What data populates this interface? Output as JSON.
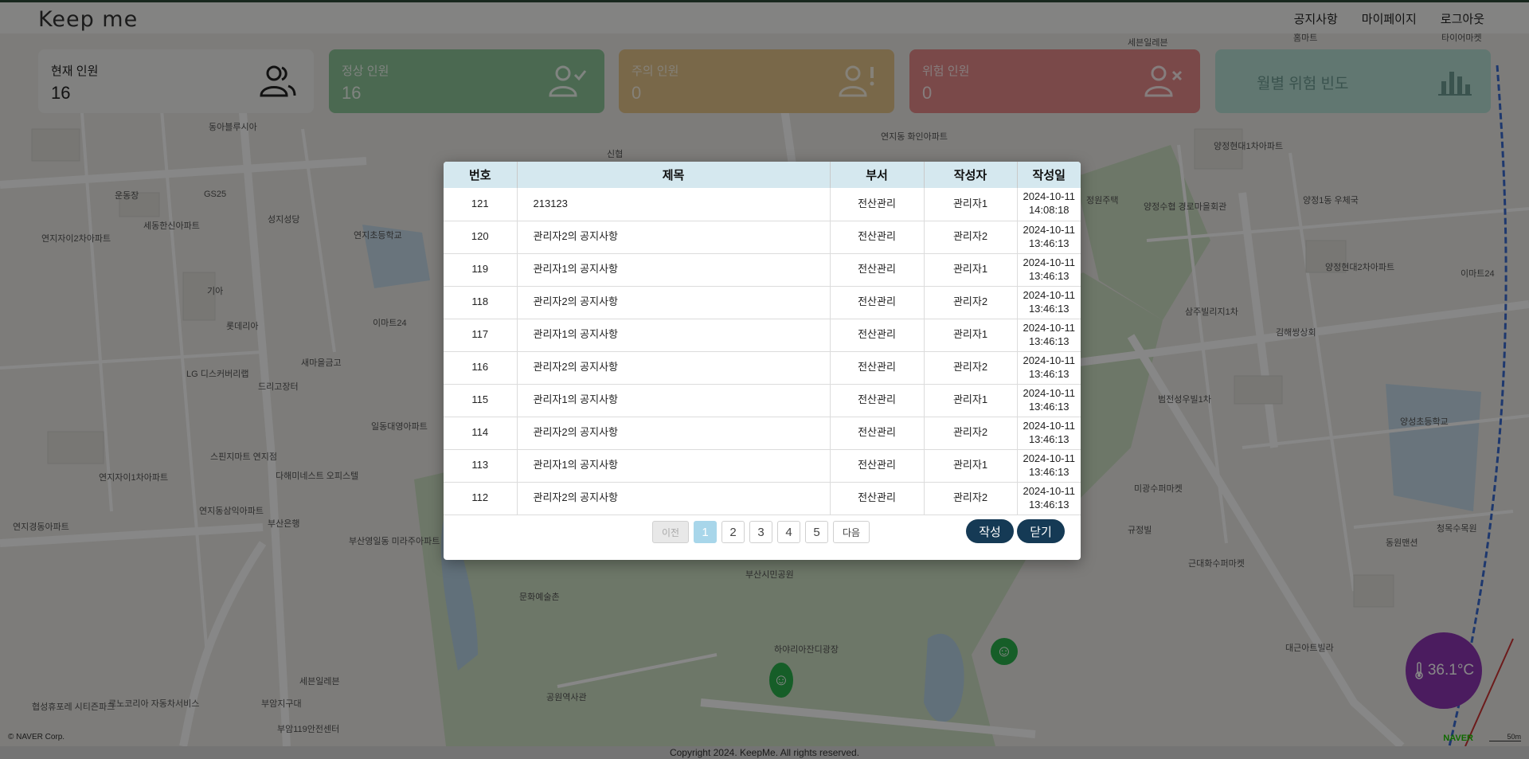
{
  "header": {
    "logo": "Keep me",
    "nav": [
      "공지사항",
      "마이페이지",
      "로그아웃"
    ]
  },
  "cards": {
    "current": {
      "label": "현재 인원",
      "value": "16"
    },
    "normal": {
      "label": "정상 인원",
      "value": "16"
    },
    "caution": {
      "label": "주의 인원",
      "value": "0"
    },
    "danger": {
      "label": "위험 인원",
      "value": "0"
    },
    "monthly": {
      "label": "월별 위험 빈도"
    }
  },
  "map": {
    "labels": [
      "동아블루시아",
      "운동장",
      "세동한신아파트",
      "연지자이2차아파트",
      "GS25",
      "성지성당",
      "연지초등학교",
      "기아",
      "롯데리아",
      "이마트24",
      "LG 디스커버리랩",
      "새마을금고",
      "드리고장터",
      "일동대영아파트",
      "스핀지마트 연지점",
      "다해미네스트 오피스텔",
      "연지자이1차아파트",
      "연지동삼익아파트",
      "부산은행",
      "부산영일동 미라주아파트",
      "연지경동아파트",
      "문화예술촌",
      "부산시민공원",
      "하야리아잔디광장",
      "공원역사관",
      "세븐일레븐",
      "르노코리아 자동차서비스",
      "부암지구대",
      "부암119안전센터",
      "협성휴포레 시티즌파크",
      "연지동 화인아파트",
      "정원주택",
      "양정수협 경로마을회관",
      "양정현대1차아파트",
      "양정1동 우체국",
      "양정현대2차아파트",
      "삼주빌리지1차",
      "김해쌍상회",
      "범전성우빌1차",
      "양성초등학교",
      "미광수퍼마켓",
      "규정빌",
      "근대화수퍼마켓",
      "청목수목원",
      "동원맨션",
      "대근아트빌라",
      "신협",
      "이마트24",
      "타이어마켓",
      "세븐일레븐",
      "홈마트"
    ],
    "credit": "© NAVER Corp.",
    "naver": "NAVER",
    "scale": "50m"
  },
  "modal": {
    "columns": [
      "번호",
      "제목",
      "부서",
      "작성자",
      "작성일"
    ],
    "rows": [
      {
        "no": "121",
        "title": "213123",
        "dept": "전산관리",
        "author": "관리자1",
        "date": "2024-10-11",
        "time": "14:08:18"
      },
      {
        "no": "120",
        "title": "관리자2의 공지사항",
        "dept": "전산관리",
        "author": "관리자2",
        "date": "2024-10-11",
        "time": "13:46:13"
      },
      {
        "no": "119",
        "title": "관리자1의 공지사항",
        "dept": "전산관리",
        "author": "관리자1",
        "date": "2024-10-11",
        "time": "13:46:13"
      },
      {
        "no": "118",
        "title": "관리자2의 공지사항",
        "dept": "전산관리",
        "author": "관리자2",
        "date": "2024-10-11",
        "time": "13:46:13"
      },
      {
        "no": "117",
        "title": "관리자1의 공지사항",
        "dept": "전산관리",
        "author": "관리자1",
        "date": "2024-10-11",
        "time": "13:46:13"
      },
      {
        "no": "116",
        "title": "관리자2의 공지사항",
        "dept": "전산관리",
        "author": "관리자2",
        "date": "2024-10-11",
        "time": "13:46:13"
      },
      {
        "no": "115",
        "title": "관리자1의 공지사항",
        "dept": "전산관리",
        "author": "관리자1",
        "date": "2024-10-11",
        "time": "13:46:13"
      },
      {
        "no": "114",
        "title": "관리자2의 공지사항",
        "dept": "전산관리",
        "author": "관리자2",
        "date": "2024-10-11",
        "time": "13:46:13"
      },
      {
        "no": "113",
        "title": "관리자1의 공지사항",
        "dept": "전산관리",
        "author": "관리자1",
        "date": "2024-10-11",
        "time": "13:46:13"
      },
      {
        "no": "112",
        "title": "관리자2의 공지사항",
        "dept": "전산관리",
        "author": "관리자2",
        "date": "2024-10-11",
        "time": "13:46:13"
      }
    ],
    "pagination": {
      "prev": "이전",
      "pages": [
        "1",
        "2",
        "3",
        "4",
        "5"
      ],
      "active": "1",
      "next": "다음"
    },
    "write_label": "작성",
    "close_label": "닫기"
  },
  "temperature": "36.1°C",
  "footer": "Copyright 2024. KeepMe. All rights reserved.",
  "colors": {
    "header_accent": "#2f4a3a",
    "normal": "#4caf50",
    "caution": "#e0a020",
    "danger": "#e53935",
    "monthly": "#80cbc4",
    "button": "#153a55",
    "table_header": "#d5e8ef",
    "temperature": "#8e36b4"
  }
}
